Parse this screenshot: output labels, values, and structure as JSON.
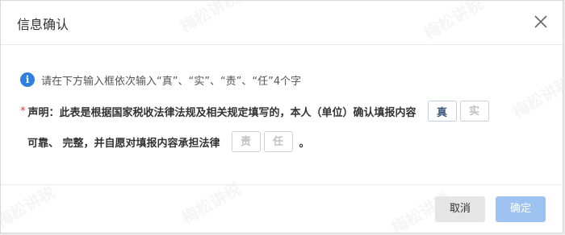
{
  "dialog": {
    "title": "信息确认",
    "close_icon": "close-icon"
  },
  "info": {
    "icon": "info-icon",
    "icon_glyph": "i",
    "text": "请在下方输入框依次输入“真”、“实”、“责”、“任”4个字"
  },
  "declaration": {
    "required_mark": "*",
    "line1": "声明：此表是根据国家税收法律法规及相关规定填写的，本人（单位）确认填报内容",
    "line2": "可靠、 完整，并自愿对填报内容承担法律",
    "end_mark": "。",
    "inputs": [
      {
        "value": "真",
        "placeholder": ""
      },
      {
        "value": "",
        "placeholder": "实"
      },
      {
        "value": "",
        "placeholder": "责"
      },
      {
        "value": "",
        "placeholder": "任"
      }
    ]
  },
  "footer": {
    "cancel_label": "取消",
    "confirm_label": "确定"
  },
  "watermark": {
    "text": "梅松讲税"
  },
  "colors": {
    "accent": "#2f7fe0",
    "confirm_disabled": "#9ec3f0",
    "required": "#e63b3b"
  }
}
